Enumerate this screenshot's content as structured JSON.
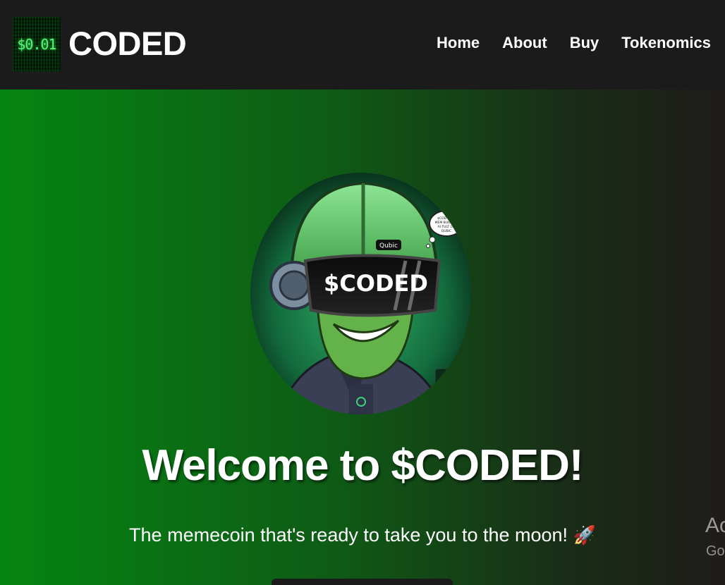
{
  "header": {
    "logo_text": "$0.01",
    "brand_name": "CODED",
    "nav": [
      {
        "label": "Home"
      },
      {
        "label": "About"
      },
      {
        "label": "Buy"
      },
      {
        "label": "Tokenomics"
      }
    ]
  },
  "hero": {
    "image": {
      "visor_text": "$CODED",
      "helmet_badge": "Qubic",
      "speech_bubble": "$COD COIN MEM BUILT ON AI TULT ON QUBIC"
    },
    "title": "Welcome to $CODED!",
    "subtitle": "The memecoin that's ready to take you to the moon!",
    "subtitle_emoji": "🚀"
  },
  "overlay": {
    "activate_title": "Ac",
    "activate_sub": "Go"
  },
  "colors": {
    "hero_green": "#058512",
    "header_bg": "#1b1b1b",
    "logo_green": "#5cf07a"
  }
}
